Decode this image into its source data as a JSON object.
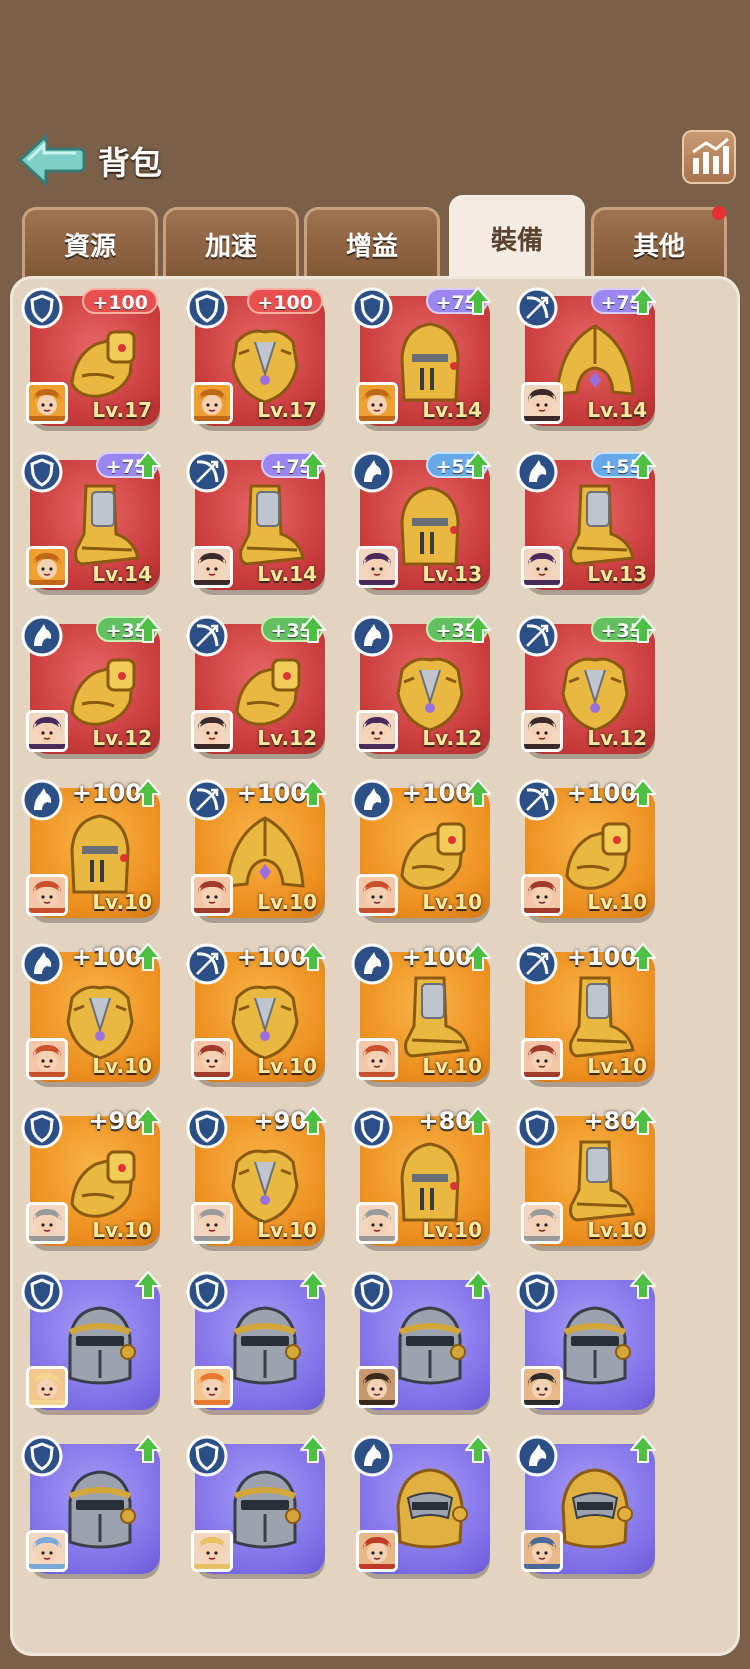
{
  "header": {
    "title": "背包"
  },
  "tabs": [
    {
      "label": "資源",
      "active": false
    },
    {
      "label": "加速",
      "active": false
    },
    {
      "label": "增益",
      "active": false
    },
    {
      "label": "裝備",
      "active": true
    },
    {
      "label": "其他",
      "active": false
    }
  ],
  "colors": {
    "red": "#c83a3a",
    "orange": "#ec8e1e",
    "purple": "#8070e8",
    "upgrade_green": "#4cc040"
  },
  "items": [
    {
      "rarity": "red",
      "equip": "gauntlet",
      "class": "shield",
      "bonus": "+100",
      "bonus_style": "red",
      "upgrade": false,
      "hero": "spartan",
      "level": "Lv.17"
    },
    {
      "rarity": "red",
      "equip": "armor",
      "class": "shield",
      "bonus": "+100",
      "bonus_style": "red",
      "upgrade": false,
      "hero": "spartan",
      "level": "Lv.17"
    },
    {
      "rarity": "red",
      "equip": "knight-helm",
      "class": "shield",
      "bonus": "+75",
      "bonus_style": "purple",
      "upgrade": true,
      "hero": "spartan",
      "level": "Lv.14"
    },
    {
      "rarity": "red",
      "equip": "hood-helm",
      "class": "bow",
      "bonus": "+75",
      "bonus_style": "purple",
      "upgrade": true,
      "hero": "archer-girl",
      "level": "Lv.14"
    },
    {
      "rarity": "red",
      "equip": "boot",
      "class": "shield",
      "bonus": "+75",
      "bonus_style": "purple",
      "upgrade": true,
      "hero": "spartan",
      "level": "Lv.14"
    },
    {
      "rarity": "red",
      "equip": "boot",
      "class": "bow",
      "bonus": "+75",
      "bonus_style": "purple",
      "upgrade": true,
      "hero": "archer-girl",
      "level": "Lv.14"
    },
    {
      "rarity": "red",
      "equip": "knight-helm",
      "class": "horse",
      "bonus": "+55",
      "bonus_style": "blue",
      "upgrade": true,
      "hero": "rider-girl",
      "level": "Lv.13"
    },
    {
      "rarity": "red",
      "equip": "boot",
      "class": "horse",
      "bonus": "+55",
      "bonus_style": "blue",
      "upgrade": true,
      "hero": "rider-girl",
      "level": "Lv.13"
    },
    {
      "rarity": "red",
      "equip": "gauntlet",
      "class": "horse",
      "bonus": "+35",
      "bonus_style": "green",
      "upgrade": true,
      "hero": "rider-girl",
      "level": "Lv.12"
    },
    {
      "rarity": "red",
      "equip": "gauntlet",
      "class": "bow",
      "bonus": "+35",
      "bonus_style": "green",
      "upgrade": true,
      "hero": "archer-girl",
      "level": "Lv.12"
    },
    {
      "rarity": "red",
      "equip": "armor",
      "class": "horse",
      "bonus": "+35",
      "bonus_style": "green",
      "upgrade": true,
      "hero": "rider-girl",
      "level": "Lv.12"
    },
    {
      "rarity": "red",
      "equip": "armor",
      "class": "bow",
      "bonus": "+35",
      "bonus_style": "green",
      "upgrade": true,
      "hero": "archer-girl",
      "level": "Lv.12"
    },
    {
      "rarity": "orange",
      "equip": "knight-helm",
      "class": "horse",
      "bonus": "+100",
      "bonus_style": "big",
      "upgrade": true,
      "hero": "redhead",
      "level": "Lv.10"
    },
    {
      "rarity": "orange",
      "equip": "hood-helm",
      "class": "bow",
      "bonus": "+100",
      "bonus_style": "big",
      "upgrade": true,
      "hero": "beard-man",
      "level": "Lv.10"
    },
    {
      "rarity": "orange",
      "equip": "gauntlet",
      "class": "horse",
      "bonus": "+100",
      "bonus_style": "big",
      "upgrade": true,
      "hero": "redhead",
      "level": "Lv.10"
    },
    {
      "rarity": "orange",
      "equip": "gauntlet",
      "class": "bow",
      "bonus": "+100",
      "bonus_style": "big",
      "upgrade": true,
      "hero": "beard-man",
      "level": "Lv.10"
    },
    {
      "rarity": "orange",
      "equip": "armor",
      "class": "horse",
      "bonus": "+100",
      "bonus_style": "big",
      "upgrade": true,
      "hero": "redhead",
      "level": "Lv.10"
    },
    {
      "rarity": "orange",
      "equip": "armor",
      "class": "bow",
      "bonus": "+100",
      "bonus_style": "big",
      "upgrade": true,
      "hero": "beard-man",
      "level": "Lv.10"
    },
    {
      "rarity": "orange",
      "equip": "boot",
      "class": "horse",
      "bonus": "+100",
      "bonus_style": "big",
      "upgrade": true,
      "hero": "redhead",
      "level": "Lv.10"
    },
    {
      "rarity": "orange",
      "equip": "boot",
      "class": "bow",
      "bonus": "+100",
      "bonus_style": "big",
      "upgrade": true,
      "hero": "beard-man",
      "level": "Lv.10"
    },
    {
      "rarity": "orange",
      "equip": "gauntlet",
      "class": "shield",
      "bonus": "+90",
      "bonus_style": "big",
      "upgrade": true,
      "hero": "old-man",
      "level": "Lv.10"
    },
    {
      "rarity": "orange",
      "equip": "armor",
      "class": "shield",
      "bonus": "+90",
      "bonus_style": "big",
      "upgrade": true,
      "hero": "old-man",
      "level": "Lv.10"
    },
    {
      "rarity": "orange",
      "equip": "knight-helm",
      "class": "shield",
      "bonus": "+80",
      "bonus_style": "big",
      "upgrade": true,
      "hero": "old-man",
      "level": "Lv.10"
    },
    {
      "rarity": "orange",
      "equip": "boot",
      "class": "shield",
      "bonus": "+80",
      "bonus_style": "big",
      "upgrade": true,
      "hero": "old-man",
      "level": "Lv.10"
    },
    {
      "rarity": "purple",
      "equip": "steel-helm",
      "class": "shield",
      "bonus": "",
      "bonus_style": "none",
      "upgrade": true,
      "hero": "blonde-elder",
      "level": ""
    },
    {
      "rarity": "purple",
      "equip": "steel-helm",
      "class": "shield",
      "bonus": "",
      "bonus_style": "none",
      "upgrade": true,
      "hero": "ginger-dwarf",
      "level": ""
    },
    {
      "rarity": "purple",
      "equip": "steel-helm",
      "class": "shield",
      "bonus": "",
      "bonus_style": "none",
      "upgrade": true,
      "hero": "dark-beard",
      "level": ""
    },
    {
      "rarity": "purple",
      "equip": "steel-helm",
      "class": "shield",
      "bonus": "",
      "bonus_style": "none",
      "upgrade": true,
      "hero": "egypt-girl",
      "level": ""
    },
    {
      "rarity": "purple",
      "equip": "steel-helm",
      "class": "shield",
      "bonus": "",
      "bonus_style": "none",
      "upgrade": true,
      "hero": "blue-knight",
      "level": ""
    },
    {
      "rarity": "purple",
      "equip": "steel-helm",
      "class": "shield",
      "bonus": "",
      "bonus_style": "none",
      "upgrade": true,
      "hero": "blonde-boy",
      "level": ""
    },
    {
      "rarity": "purple",
      "equip": "gold-helm",
      "class": "horse",
      "bonus": "",
      "bonus_style": "none",
      "upgrade": true,
      "hero": "red-viking",
      "level": ""
    },
    {
      "rarity": "purple",
      "equip": "gold-helm",
      "class": "horse",
      "bonus": "",
      "bonus_style": "none",
      "upgrade": true,
      "hero": "blue-warrior",
      "level": ""
    }
  ]
}
